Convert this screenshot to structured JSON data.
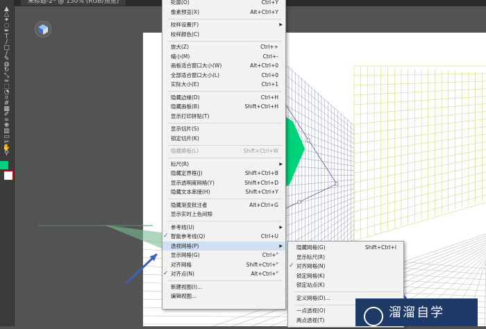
{
  "document_tab": {
    "title": "未标题-2* @ 150% (RGB/预览)"
  },
  "toolbar": {
    "tools": [
      "selection",
      "direct-selection",
      "magic-wand",
      "lasso",
      "pen",
      "type",
      "line",
      "rectangle",
      "paintbrush",
      "pencil",
      "eraser",
      "rotate",
      "scale",
      "warp",
      "free-transform",
      "shape-builder",
      "perspective-grid",
      "mesh",
      "gradient",
      "eyedropper",
      "blend",
      "symbol-sprayer",
      "column-graph",
      "artboard",
      "slice",
      "hand",
      "zoom"
    ],
    "fill_color": "#00d27a",
    "stroke_color": "#ffffff"
  },
  "view_menu": {
    "items": [
      {
        "label": "轮廓(O)",
        "shortcut": "Ctrl+Y",
        "partial": true
      },
      {
        "label": "像素预览(X)",
        "shortcut": "Alt+Ctrl+Y"
      },
      {
        "sep": true
      },
      {
        "label": "校样设置(F)",
        "submenu": true
      },
      {
        "label": "校样颜色(C)"
      },
      {
        "sep": true
      },
      {
        "label": "放大(Z)",
        "shortcut": "Ctrl++"
      },
      {
        "label": "缩小(M)",
        "shortcut": "Ctrl+-"
      },
      {
        "label": "画板适合窗口大小(W)",
        "shortcut": "Alt+Ctrl+0"
      },
      {
        "label": "全部适合窗口大小(L)",
        "shortcut": "Ctrl+0"
      },
      {
        "label": "实际大小(E)",
        "shortcut": "Ctrl+1"
      },
      {
        "sep": true
      },
      {
        "label": "隐藏边缘(D)",
        "shortcut": "Ctrl+H"
      },
      {
        "label": "隐藏画板(B)",
        "shortcut": "Shift+Ctrl+H"
      },
      {
        "label": "显示打印拼贴(T)"
      },
      {
        "sep": true
      },
      {
        "label": "显示切片(S)"
      },
      {
        "label": "锁定切片(K)"
      },
      {
        "sep": true
      },
      {
        "label": "隐藏模板(L)",
        "shortcut": "Shift+Ctrl+W",
        "disabled": true
      },
      {
        "sep": true
      },
      {
        "label": "标尺(R)",
        "submenu": true
      },
      {
        "label": "隐藏定界框(J)",
        "shortcut": "Shift+Ctrl+B"
      },
      {
        "label": "显示透明度网格(Y)",
        "shortcut": "Shift+Ctrl+D"
      },
      {
        "label": "隐藏文本串接(H)",
        "shortcut": "Shift+Ctrl+Y"
      },
      {
        "sep": true
      },
      {
        "label": "隐藏渐变批注者",
        "shortcut": "Alt+Ctrl+G"
      },
      {
        "label": "显示实时上色间隙"
      },
      {
        "sep": true
      },
      {
        "label": "参考线(U)",
        "submenu": true
      },
      {
        "label": "智能参考线(Q)",
        "shortcut": "Ctrl+U",
        "checked": true
      },
      {
        "label": "透视网格(P)",
        "submenu": true,
        "highlighted": true
      },
      {
        "label": "显示网格(G)",
        "shortcut": "Ctrl+\""
      },
      {
        "label": "对齐网格",
        "shortcut": "Shift+Ctrl+\""
      },
      {
        "label": "对齐点(N)",
        "shortcut": "Alt+Ctrl+\"",
        "checked": true
      },
      {
        "sep": true
      },
      {
        "label": "新建视图(I)..."
      },
      {
        "label": "编辑视图..."
      }
    ]
  },
  "perspective_submenu": {
    "items": [
      {
        "label": "隐藏网格(G)",
        "shortcut": "Shift+Ctrl+I"
      },
      {
        "label": "显示标尺(R)"
      },
      {
        "label": "对齐网格(N)",
        "checked": true
      },
      {
        "label": "锁定网格(K)"
      },
      {
        "label": "锁定站点(K)"
      },
      {
        "sep": true
      },
      {
        "label": "定义网格(D)..."
      },
      {
        "sep": true
      },
      {
        "label": "一点透视(O)"
      },
      {
        "label": "两点透视(T)"
      }
    ]
  },
  "artwork": {
    "shape_color": "#00d27a",
    "grid_color_left": "#8c95b8",
    "grid_color_right": "#cdd26a",
    "arrow_color": "#3a63b8"
  },
  "watermark": {
    "text": "溜溜自学"
  }
}
